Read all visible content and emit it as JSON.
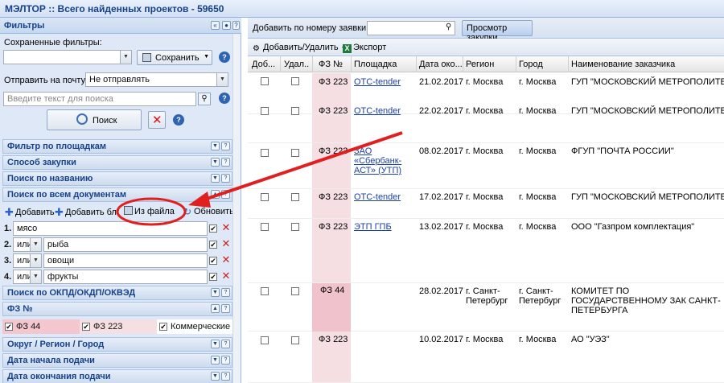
{
  "window": {
    "title": "МЭЛТОР :: Всего найденных проектов - 59650"
  },
  "colors": {
    "accent": "#15428b",
    "fz44_bg": "#f4c7cf",
    "fz223_bg": "#f6dfe2",
    "annotation": "#e02020"
  },
  "filters": {
    "header": "Фильтры",
    "saved_label": "Сохраненные фильтры:",
    "saved_value": "",
    "save_button": "Сохранить",
    "email_label": "Отправить на почту:",
    "email_value": "Не отправлять",
    "search_placeholder": "Введите текст для поиска",
    "search_button": "Поиск",
    "sections": {
      "platforms": "Фильтр по площадкам",
      "method": "Способ закупки",
      "by_name": "Поиск по названию",
      "all_docs": "Поиск по всем документам",
      "okpd": "Поиск по ОКПД/ОКДП/ОКВЭД",
      "fz": "ФЗ №",
      "region": "Округ / Регион / Город",
      "start_date": "Дата начала подачи",
      "end_date": "Дата окончания подачи"
    },
    "doc_toolbar": {
      "add": "Добавить",
      "add_block": "Добавить блок",
      "from_file": "Из файла",
      "refresh": "Обновить"
    },
    "terms": [
      {
        "num": "1.",
        "op": "",
        "text": "мясо"
      },
      {
        "num": "2.",
        "op": "или",
        "text": "рыба"
      },
      {
        "num": "3.",
        "op": "или",
        "text": "овощи"
      },
      {
        "num": "4.",
        "op": "или",
        "text": "фрукты"
      }
    ],
    "fz_options": {
      "fz44": "ФЗ 44",
      "fz223": "ФЗ 223",
      "commercial": "Коммерческие"
    }
  },
  "results": {
    "add_by_number_label": "Добавить по номеру заявки:",
    "view_button": "Просмотр закупки",
    "add_remove": "Добавить/Удалить",
    "export": "Экспорт",
    "columns": [
      "Доб...",
      "Удал...",
      "ФЗ №",
      "Площадка",
      "Дата око...",
      "Регион",
      "Город",
      "Наименование заказчика"
    ],
    "rows": [
      {
        "fz": "ФЗ 223",
        "platform": "OTC-tender",
        "platform_lines": [
          "OTC-tender"
        ],
        "date": "21.02.2017",
        "region": "г. Москва",
        "city": "г. Москва",
        "customer": "ГУП \"МОСКОВСКИЙ МЕТРОПОЛИТЕН\""
      },
      {
        "fz": "ФЗ 223",
        "platform": "OTC-tender",
        "platform_lines": [
          "OTC-tender"
        ],
        "date": "22.02.2017",
        "region": "г. Москва",
        "city": "г. Москва",
        "customer": "ГУП \"МОСКОВСКИЙ МЕТРОПОЛИТЕН\""
      },
      {
        "fz": "ФЗ 223",
        "platform": "ЗАО «Сбербанк-АСТ» (УТП)",
        "platform_lines": [
          "ЗАО",
          "«Сбербанк-",
          "АСТ» (УТП)"
        ],
        "date": "08.02.2017",
        "region": "г. Москва",
        "city": "г. Москва",
        "customer": "ФГУП \"ПОЧТА РОССИИ\""
      },
      {
        "fz": "ФЗ 223",
        "platform": "OTC-tender",
        "platform_lines": [
          "OTC-tender"
        ],
        "date": "17.02.2017",
        "region": "г. Москва",
        "city": "г. Москва",
        "customer": "ГУП \"МОСКОВСКИЙ МЕТРОПОЛИТЕН\""
      },
      {
        "fz": "ФЗ 223",
        "platform": "ЭТП ГПБ",
        "platform_lines": [
          "ЭТП ГПБ"
        ],
        "date": "13.02.2017",
        "region": "г. Москва",
        "city": "г. Москва",
        "customer": "ООО \"Газпром комплектация\""
      },
      {
        "fz": "ФЗ 44",
        "platform": "",
        "platform_lines": [
          ""
        ],
        "date": "28.02.2017",
        "region": "г. Санкт-Петербург",
        "city": "г. Санкт-Петербург",
        "customer": "КОМИТЕТ ПО ГОСУДАРСТВЕННОМУ ЗАК САНКТ-ПЕТЕРБУРГА"
      },
      {
        "fz": "ФЗ 223",
        "platform": "",
        "platform_lines": [
          ""
        ],
        "date": "10.02.2017",
        "region": "г. Москва",
        "city": "г. Москва",
        "customer": "АО \"УЭЗ\""
      }
    ]
  }
}
